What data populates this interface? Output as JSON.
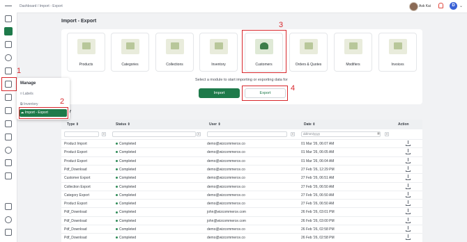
{
  "breadcrumb": {
    "root": "Dashboard",
    "separator": "/",
    "current": "Import - Export"
  },
  "user": {
    "name": "Ask Kai",
    "initial": "D"
  },
  "page": {
    "title": "Import - Export"
  },
  "modules": [
    {
      "label": "Products",
      "icon": "products-icon"
    },
    {
      "label": "Categories",
      "icon": "categories-icon"
    },
    {
      "label": "Collections",
      "icon": "collections-icon"
    },
    {
      "label": "Inventory",
      "icon": "inventory-icon"
    },
    {
      "label": "Customers",
      "icon": "customers-icon",
      "selected": true
    },
    {
      "label": "Orders & Quotes",
      "icon": "orders-quotes-icon"
    },
    {
      "label": "Modifiers",
      "icon": "modifiers-icon"
    },
    {
      "label": "Invoices",
      "icon": "invoices-icon"
    }
  ],
  "prompt": "Select a module to start importing or exporting data for",
  "buttons": {
    "import": "Import",
    "export": "Export"
  },
  "history": {
    "title": "ory",
    "columns": {
      "type": "Type",
      "status": "Status",
      "user": "User",
      "date": "Date",
      "action": "Action"
    },
    "date_placeholder": "dd/mm/yyyy",
    "rows": [
      {
        "type": "Product Import",
        "status": "Completed",
        "user": "demo@wizcommerce.co",
        "date": "01 Mar '26, 06:07 AM"
      },
      {
        "type": "Product Export",
        "status": "Completed",
        "user": "demo@wizcommerce.co",
        "date": "01 Mar '26, 06:05 AM"
      },
      {
        "type": "Product Export",
        "status": "Completed",
        "user": "demo@wizcommerce.co",
        "date": "01 Mar '26, 06:04 AM"
      },
      {
        "type": "Pdf_Download",
        "status": "Completed",
        "user": "demo@wizcommerce.co",
        "date": "27 Feb '26, 12:29 PM"
      },
      {
        "type": "Customer Export",
        "status": "Completed",
        "user": "demo@wizcommerce.co",
        "date": "27 Feb '26, 06:51 AM"
      },
      {
        "type": "Collection Export",
        "status": "Completed",
        "user": "demo@wizcommerce.co",
        "date": "27 Feb '26, 06:50 AM"
      },
      {
        "type": "Category Export",
        "status": "Completed",
        "user": "demo@wizcommerce.co",
        "date": "27 Feb '26, 06:50 AM"
      },
      {
        "type": "Product Export",
        "status": "Completed",
        "user": "demo@wizcommerce.co",
        "date": "27 Feb '26, 06:50 AM"
      },
      {
        "type": "Pdf_Download",
        "status": "Completed",
        "user": "john@wizcommerce.com",
        "date": "26 Feb '26, 03:01 PM"
      },
      {
        "type": "Pdf_Download",
        "status": "Completed",
        "user": "john@wizcommerce.com",
        "date": "26 Feb '26, 03:00 PM"
      },
      {
        "type": "Pdf_Download",
        "status": "Completed",
        "user": "demo@wizcommerce.co",
        "date": "26 Feb '26, 02:58 PM"
      },
      {
        "type": "Pdf_Download",
        "status": "Completed",
        "user": "demo@wizcommerce.co",
        "date": "26 Feb '26, 02:58 PM"
      }
    ]
  },
  "manage_menu": {
    "title": "Manage",
    "items": [
      {
        "label": "Labels",
        "icon": "tag-icon"
      },
      {
        "label": "Inventory",
        "icon": "box-icon"
      },
      {
        "label": "Import - Export",
        "icon": "cloud-sync-icon",
        "active": true
      }
    ]
  },
  "annotations": [
    "1",
    "2",
    "3",
    "4"
  ],
  "colors": {
    "accent": "#1e7a4a",
    "annotation": "#d8262b"
  }
}
